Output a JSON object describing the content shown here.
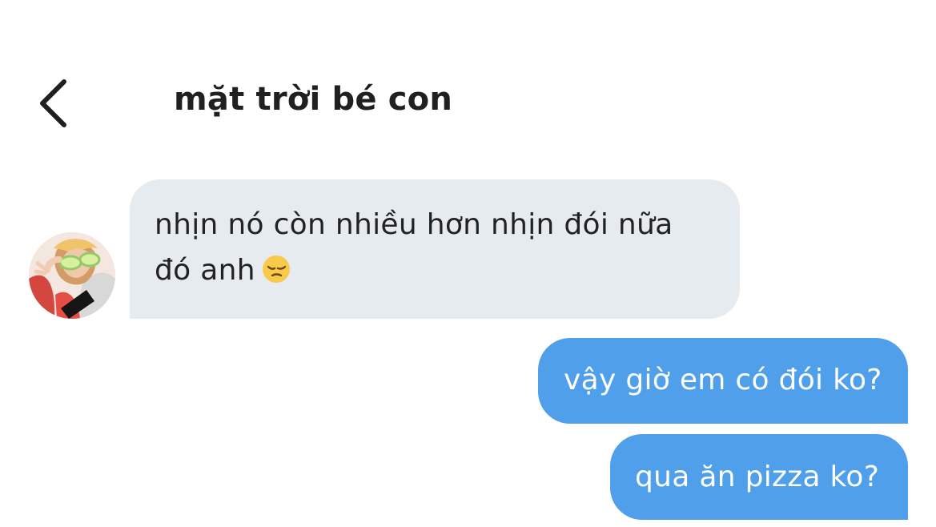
{
  "header": {
    "back_icon": "chevron-left-icon",
    "title": "mặt trời bé con"
  },
  "conversation": {
    "contact_avatar": "avatar-photo",
    "messages": [
      {
        "direction": "incoming",
        "line_1": "nhịn nó còn nhiều hơn nhịn đói nữa",
        "line_2": "đó anh",
        "emoji": "pensive-face-emoji"
      },
      {
        "direction": "outgoing",
        "text": "vậy giờ em có đói ko?"
      },
      {
        "direction": "outgoing",
        "text": "qua ăn pizza ko?"
      }
    ]
  },
  "colors": {
    "background": "#ffffff",
    "incoming_bubble": "#e6ebf0",
    "outgoing_bubble": "#4f9fea",
    "outgoing_text": "#ffffff",
    "title_text": "#202020"
  }
}
